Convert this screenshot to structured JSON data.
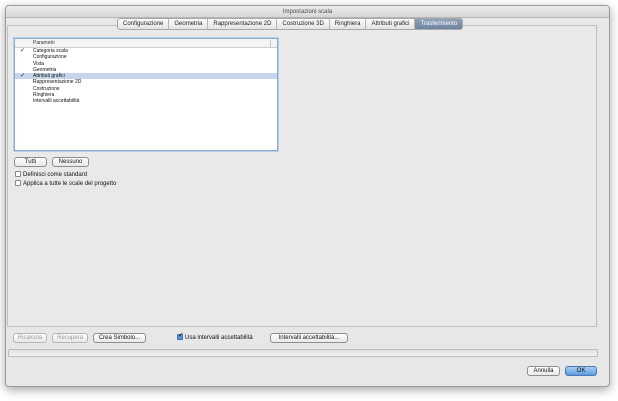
{
  "window": {
    "title": "Impostazioni scala"
  },
  "tabs": [
    {
      "label": "Configurazione"
    },
    {
      "label": "Geometria"
    },
    {
      "label": "Rappresentazione 2D"
    },
    {
      "label": "Costruzione 3D"
    },
    {
      "label": "Ringhiera"
    },
    {
      "label": "Attributi grafici"
    },
    {
      "label": "Trasferimento"
    }
  ],
  "active_tab": "Trasferimento",
  "parameters_list": {
    "header": "Parametri",
    "items": [
      {
        "label": "Categoria scala",
        "checked": true,
        "selected": false
      },
      {
        "label": "Configurazione",
        "checked": false,
        "selected": false
      },
      {
        "label": "Vista",
        "checked": false,
        "selected": false
      },
      {
        "label": "Geometria",
        "checked": false,
        "selected": false
      },
      {
        "label": "Attributi grafici",
        "checked": true,
        "selected": true
      },
      {
        "label": "Rappresentazione 2D",
        "checked": false,
        "selected": false
      },
      {
        "label": "Costruzione",
        "checked": false,
        "selected": false
      },
      {
        "label": "Ringhiera",
        "checked": false,
        "selected": false
      },
      {
        "label": "Intervalli accettabilità",
        "checked": false,
        "selected": false
      }
    ]
  },
  "selection_buttons": {
    "all": "Tutti",
    "none": "Nessuno"
  },
  "options": {
    "define_standard": {
      "label": "Definisci come standard",
      "checked": false
    },
    "apply_all": {
      "label": "Applica a tutte le scale del progetto",
      "checked": false
    }
  },
  "bottom_bar": {
    "recalc": "Ricalcola",
    "recover": "Recupera",
    "create_symbol": "Crea Simbolo...",
    "use_ranges": {
      "label": "Usa intervalli accettabilità",
      "checked": true
    },
    "ranges_button": "Intervalli accettabilità..."
  },
  "dialog_buttons": {
    "cancel": "Annulla",
    "ok": "OK"
  }
}
